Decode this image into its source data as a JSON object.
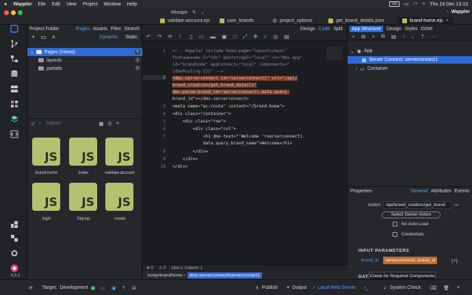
{
  "menubar": {
    "apple": "",
    "app_name": "Wappler",
    "items": [
      "File",
      "Edit",
      "View",
      "Project",
      "Window",
      "Help"
    ],
    "locale": "US",
    "datetime": "Thu 19 Dec  13:13"
  },
  "window": {
    "title": "Mixtape",
    "brand": "Wappler",
    "tabs": [
      {
        "label": "validate-account.ejs",
        "active": false
      },
      {
        "label": "user_brands",
        "active": false
      },
      {
        "label": "project_options",
        "active": false
      },
      {
        "label": "get_brand_details.json",
        "active": false
      },
      {
        "label": "brand-home.ejs",
        "active": true
      }
    ]
  },
  "project": {
    "title": "Project Folder",
    "tabs": [
      "Pages",
      "Assets",
      "Files",
      "Search"
    ],
    "mode_dynamic": "Dynamic",
    "mode_static": "Static",
    "tree": [
      {
        "label": "Pages (Views)",
        "count": "6",
        "selected": true
      },
      {
        "label": "layouts",
        "count": "1",
        "selected": false
      },
      {
        "label": "partials",
        "count": "0",
        "selected": false
      }
    ],
    "search_placeholder": "Search",
    "files": [
      {
        "name": "brand-home",
        "icon": "JS"
      },
      {
        "name": "index",
        "icon": "JS"
      },
      {
        "name": "validate-account",
        "icon": "JS"
      },
      {
        "name": "login",
        "icon": "JS"
      },
      {
        "name": "Signup",
        "icon": "JS"
      },
      {
        "name": "create",
        "icon": "JS"
      }
    ]
  },
  "editor": {
    "view_tabs": [
      "Design",
      "Code",
      "Split"
    ],
    "active_view": "Code",
    "line_numbers": [
      "1",
      "2",
      "3",
      "4",
      "5",
      "6",
      "7",
      "8",
      "9",
      "10"
    ],
    "lines": [
      "<!-- Wappler include head-page=\"layouts/main\"",
      "fontawesome_5=\"cdn\" bootstrap5=\"local\" is=\"dmx-app\"",
      "id=\"brandhome\" appConnect=\"local\" components=\"",
      "{dmxRouting:{}}\" -->",
      "<dmx-serverconnect id=\"serverconnect1\" url=\"/api/",
      "brand_creation/get_brand_details\"",
      "dmx-param:brand_id=\"serverconnect1.data.query.",
      "brand_id\"></dmx-serverconnect>",
      "<meta name=\"ac:route\" content=\"/brand-home\">",
      "<div class=\"container\">",
      "    <div class=\"row\">",
      "        <div class=\"col\">",
      "            <h1 dmx-text=\"'Welcome '+serverconnect1.",
      "            data.query.brand_name\">Welcome</h1>",
      "        </div>",
      "    </div>",
      "</div>"
    ],
    "status_errors": "0",
    "status_warnings": "0",
    "cursor": "Line 2, Column 1",
    "breadcrumb_root": "body#brandhome",
    "breadcrumb_selected": "dmx-serverconnect#serverconnect1"
  },
  "structure": {
    "tabs": [
      "App Structure",
      "Design",
      "Styles",
      "DOM"
    ],
    "active_tab": "App Structure",
    "nodes": [
      {
        "label": "App",
        "level": 0,
        "selected": false
      },
      {
        "label": "Server Connect: serverconnect1",
        "level": 1,
        "selected": true
      },
      {
        "label": "Container",
        "level": 1,
        "selected": false
      }
    ]
  },
  "properties": {
    "title": "Properties",
    "tabs": [
      "General",
      "Attributes",
      "Events"
    ],
    "active_tab": "General",
    "action_label": "Action",
    "action_value": "/api/brand_creation/get_brand",
    "select_button": "Select Server Action",
    "no_auto_load": "No Auto Load",
    "credentials": "Credentials",
    "input_section": "INPUT PARAMETERS",
    "param_name": "brand_id",
    "param_value": "serverconnect1..brand_id",
    "param_bind": "{⚡}",
    "next_section": "DAT",
    "tooltip": "Check for Required Components"
  },
  "bottom": {
    "target_label": "Target:",
    "target_value": "Development",
    "publish": "Publish",
    "output": "Output",
    "server": "Local Web Server",
    "system_check": "System Check",
    "version": "6.8.0"
  },
  "colors": {
    "accent": "#2f6bd8",
    "js_card": "#b5c16f",
    "highlight": "#7a3e2c",
    "string": "#f08c6e"
  }
}
